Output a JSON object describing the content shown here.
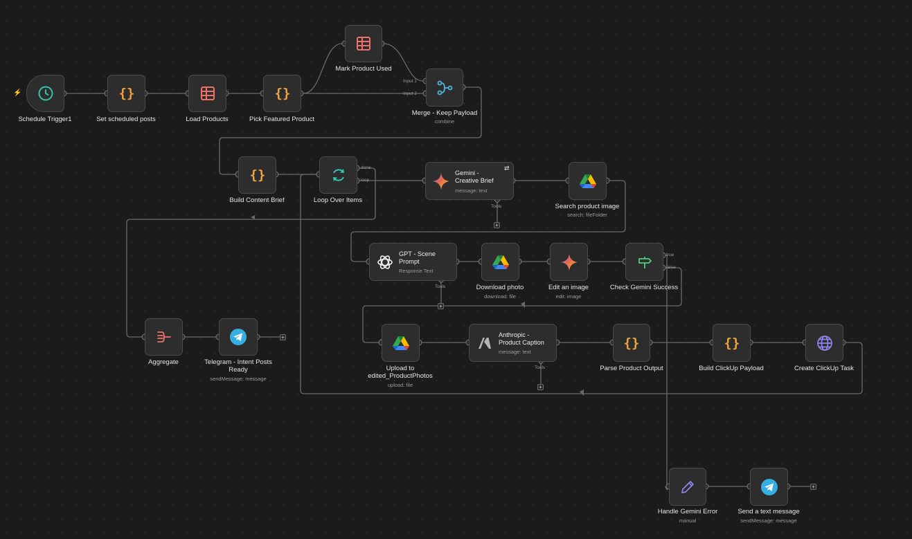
{
  "colors": {
    "canvas": "#1b1b1b",
    "node": "#2d2d2d",
    "edge": "#6a6a6a",
    "accent": "#ff6d5a",
    "code": "#f0a33c",
    "table": "#f0706a",
    "merge": "#4fb8e0",
    "loop": "#35c4b5",
    "telegram": "#37aee2",
    "pencil": "#8e86f0",
    "globe": "#8e86f0"
  },
  "nodes": {
    "schedule": {
      "label": "Schedule Trigger1",
      "icon": "clock-icon"
    },
    "set_posts": {
      "label": "Set scheduled posts",
      "icon": "code-braces-icon"
    },
    "load_products": {
      "label": "Load Products",
      "icon": "table-icon"
    },
    "pick_product": {
      "label": "Pick Featured Product",
      "icon": "code-braces-icon"
    },
    "mark_used": {
      "label": "Mark Product Used",
      "icon": "table-icon"
    },
    "merge": {
      "label": "Merge - Keep Payload",
      "sub": "combine",
      "input1": "Input 1",
      "input2": "Input 2",
      "icon": "merge-icon"
    },
    "build_brief": {
      "label": "Build Content Brief",
      "icon": "code-braces-icon"
    },
    "loop": {
      "label": "Loop Over Items",
      "done": "done",
      "loop": "loop",
      "icon": "loop-icon"
    },
    "gemini_brief": {
      "title": "Gemini -\nCreative Brief",
      "sub": "message: text",
      "tools": "Tools",
      "icon": "gemini-icon"
    },
    "search_image": {
      "label": "Search product image",
      "sub": "search: fileFolder",
      "icon": "google-drive-icon"
    },
    "gpt_scene": {
      "title": "GPT - Scene\nPrompt",
      "sub": "Response Text",
      "tools": "Tools",
      "icon": "openai-icon"
    },
    "download_photo": {
      "label": "Download photo",
      "sub": "download: file",
      "icon": "google-drive-icon"
    },
    "edit_image": {
      "label": "Edit an image",
      "sub": "edit: image",
      "icon": "gemini-icon"
    },
    "check_gemini": {
      "label": "Check Gemini Success",
      "true_lbl": "true",
      "false_lbl": "false",
      "icon": "signpost-icon"
    },
    "aggregate": {
      "label": "Aggregate",
      "icon": "aggregate-icon"
    },
    "telegram_intent": {
      "label": "Telegram - Intent Posts\nReady",
      "sub": "sendMessage: message",
      "icon": "telegram-icon"
    },
    "upload_edited": {
      "label": "Upload to\nedited_ProductPhotos",
      "sub": "upload: file",
      "icon": "google-drive-icon"
    },
    "anthropic": {
      "title": "Anthropic -\nProduct Caption",
      "sub": "message: text",
      "tools": "Tools",
      "icon": "anthropic-icon"
    },
    "parse_output": {
      "label": "Parse Product Output",
      "icon": "code-braces-icon"
    },
    "build_clickup": {
      "label": "Build ClickUp Payload",
      "icon": "code-braces-icon"
    },
    "create_clickup": {
      "label": "Create ClickUp Task",
      "icon": "globe-icon"
    },
    "handle_error": {
      "label": "Handle Gemini Error",
      "sub": "manual",
      "icon": "pencil-icon"
    },
    "send_text": {
      "label": "Send a text message",
      "sub": "sendMessage: message",
      "icon": "telegram-icon"
    }
  },
  "plus_glyph": "+"
}
